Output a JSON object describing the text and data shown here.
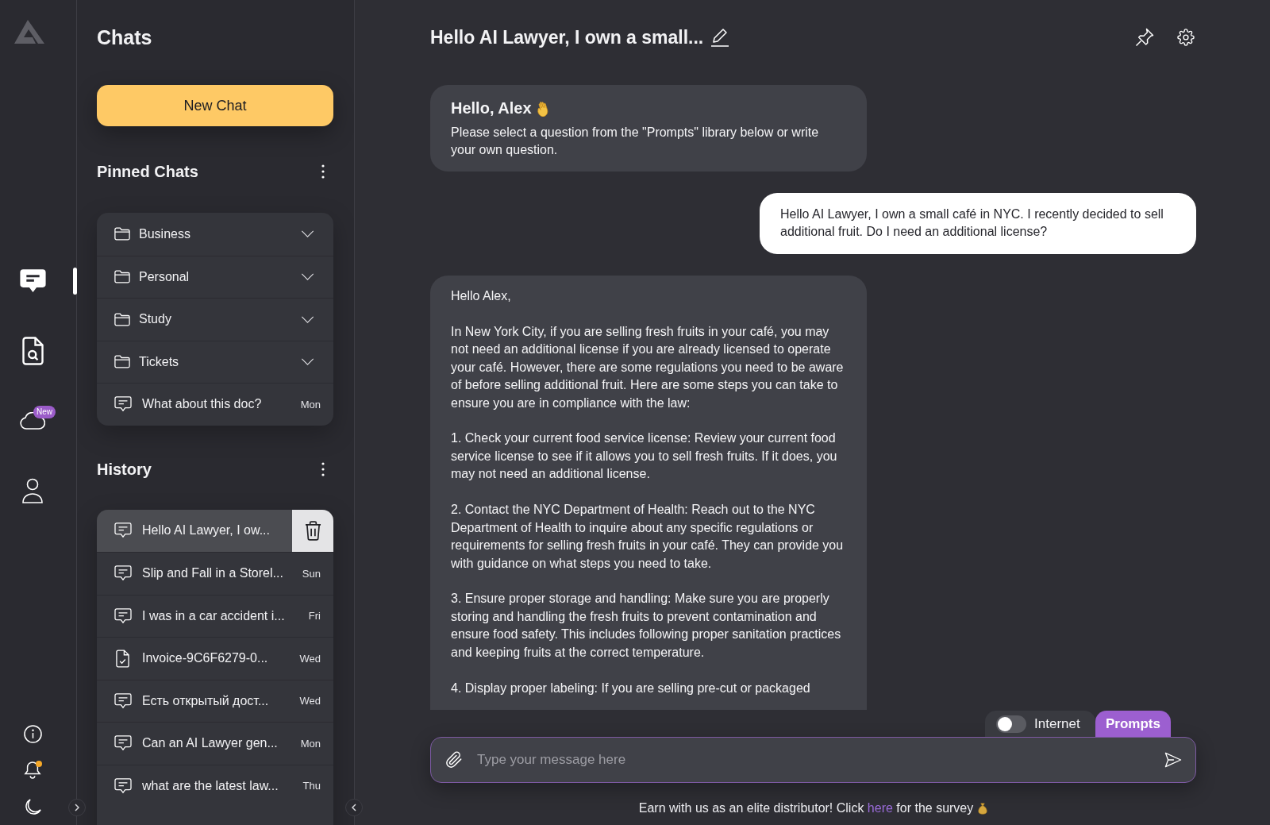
{
  "rail": {
    "nav": [
      {
        "kind": "chat",
        "selected": true
      },
      {
        "kind": "document-search",
        "selected": false
      },
      {
        "kind": "cloud",
        "selected": false,
        "badge": "New"
      },
      {
        "kind": "profile",
        "selected": false
      }
    ],
    "utilities": [
      {
        "kind": "info"
      },
      {
        "kind": "bell",
        "notification": true
      },
      {
        "kind": "moon"
      }
    ]
  },
  "sidebar": {
    "title": "Chats",
    "new_chat_button": "New Chat",
    "pinned": {
      "title": "Pinned Chats",
      "items": [
        {
          "kind": "folder",
          "label": "Business",
          "expanded": false
        },
        {
          "kind": "folder",
          "label": "Personal",
          "expanded": false
        },
        {
          "kind": "folder",
          "label": "Study",
          "expanded": false
        },
        {
          "kind": "folder",
          "label": "Tickets",
          "expanded": false
        },
        {
          "kind": "chat",
          "label": "What about this doc?",
          "time": "Mon"
        }
      ]
    },
    "history": {
      "title": "History",
      "items": [
        {
          "kind": "chat",
          "label": "Hello AI Lawyer, I ow...",
          "selected": true
        },
        {
          "kind": "chat",
          "label": "Slip and Fall in a Storel...",
          "time": "Sun",
          "selected": false
        },
        {
          "kind": "chat",
          "label": "I was in a car accident i...",
          "time": "Fri",
          "selected": false
        },
        {
          "kind": "document",
          "label": "Invoice-9C6F6279-0...",
          "time": "Wed",
          "selected": false
        },
        {
          "kind": "chat",
          "label": "Есть открытый дост...",
          "time": "Wed",
          "selected": false
        },
        {
          "kind": "chat",
          "label": "Can an AI Lawyer gen...",
          "time": "Mon",
          "selected": false
        },
        {
          "kind": "chat",
          "label": "what are the latest law...",
          "time": "Thu",
          "selected": false
        }
      ]
    }
  },
  "chat": {
    "title": "Hello AI Lawyer, I own a small...",
    "messages": [
      {
        "kind": "greeting",
        "heading": "Hello, Alex",
        "text": "Please select a question from the \"Prompts\" library below or write your own question."
      },
      {
        "kind": "user",
        "text": "Hello AI Lawyer, I own a small café in NYC. I recently decided to sell additional fruit. Do I need an additional license?"
      },
      {
        "kind": "assistant",
        "paragraphs": [
          "Hello Alex,",
          "In New York City, if you are selling fresh fruits in your café, you may not need an additional license if you are already licensed to operate your café. However, there are some regulations you need to be aware of before selling additional fruit. Here are some steps you can take to ensure you are in compliance with the law:",
          "1. Check your current food service license: Review your current food service license to see if it allows you to sell fresh fruits. If it does, you may not need an additional license.",
          "2. Contact the NYC Department of Health: Reach out to the NYC Department of Health to inquire about any specific regulations or requirements for selling fresh fruits in your café. They can provide you with guidance on what steps you need to take.",
          "3. Ensure proper storage and handling: Make sure you are properly storing and handling the fresh fruits to prevent contamination and ensure food safety. This includes following proper sanitation practices and keeping fruits at the correct temperature.",
          "4. Display proper labeling: If you are selling pre-cut or packaged"
        ]
      }
    ]
  },
  "composer": {
    "tabs": [
      {
        "kind": "toggle",
        "label": "Internet",
        "on": false
      },
      {
        "kind": "tab",
        "label": "Prompts",
        "selected": true
      }
    ],
    "placeholder": "Type your message here"
  },
  "footer": {
    "text_before": "Earn with us as an elite distributor! Click",
    "link": "here",
    "text_after": "for the survey"
  }
}
